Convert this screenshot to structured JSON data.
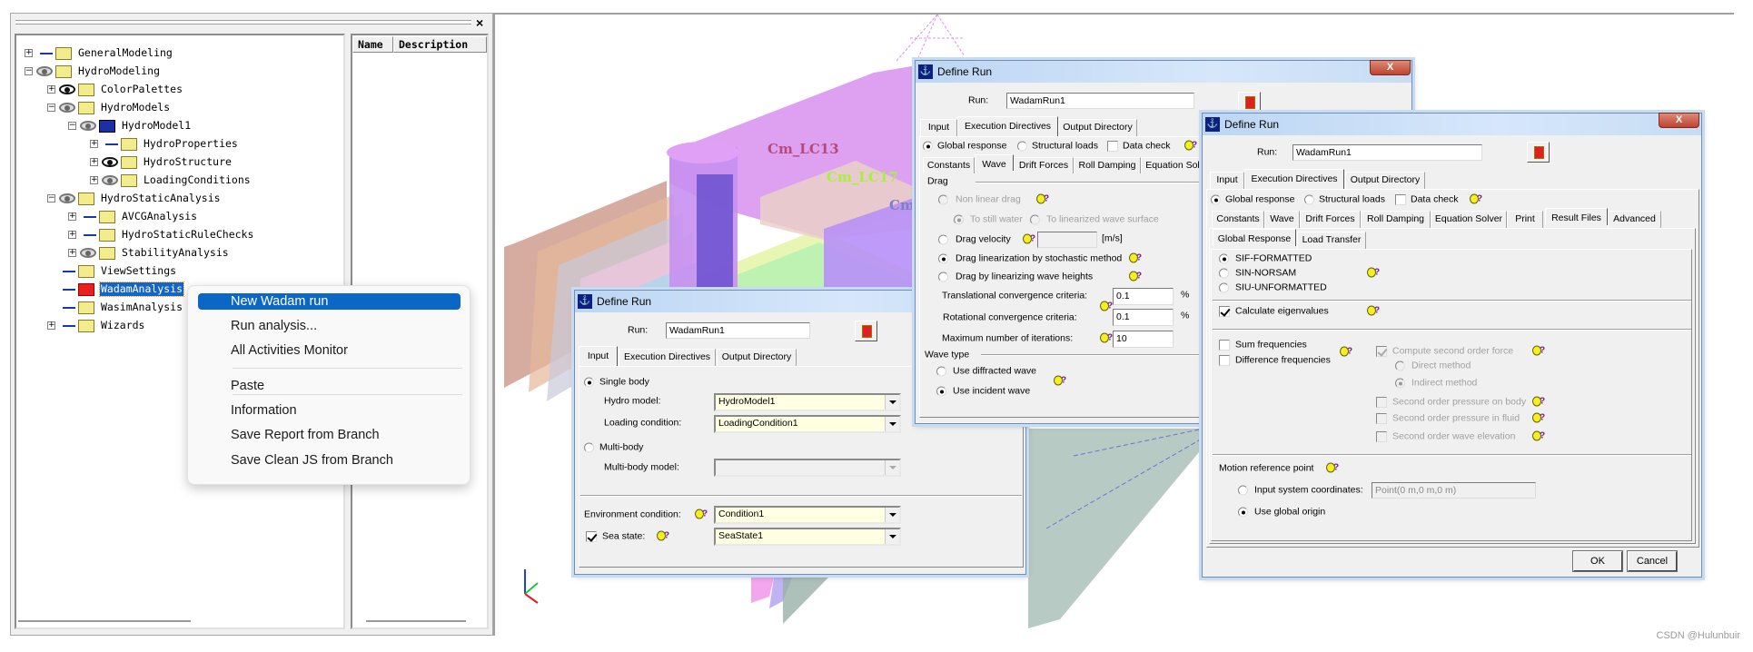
{
  "tree": [
    {
      "label": "GeneralModeling",
      "level": 0,
      "expander": "plus",
      "visibility": "hidden",
      "icon": "folder"
    },
    {
      "label": "HydroModeling",
      "level": 0,
      "expander": "minus",
      "visibility": "partial",
      "icon": "folder"
    },
    {
      "label": "ColorPalettes",
      "level": 1,
      "expander": "plus",
      "visibility": "visible",
      "icon": "folder"
    },
    {
      "label": "HydroModels",
      "level": 1,
      "expander": "minus",
      "visibility": "partial",
      "icon": "folder"
    },
    {
      "label": "HydroModel1",
      "level": 2,
      "expander": "minus",
      "visibility": "partial",
      "icon": "model"
    },
    {
      "label": "HydroProperties",
      "level": 3,
      "expander": "plus",
      "visibility": "hidden",
      "icon": "folder"
    },
    {
      "label": "HydroStructure",
      "level": 3,
      "expander": "plus",
      "visibility": "visible",
      "icon": "folder"
    },
    {
      "label": "LoadingConditions",
      "level": 3,
      "expander": "plus",
      "visibility": "partial",
      "icon": "folder"
    },
    {
      "label": "HydroStaticAnalysis",
      "level": 1,
      "expander": "minus",
      "visibility": "partial",
      "icon": "folder"
    },
    {
      "label": "AVCGAnalysis",
      "level": 2,
      "expander": "plus",
      "visibility": "hidden",
      "icon": "folder"
    },
    {
      "label": "HydroStaticRuleChecks",
      "level": 2,
      "expander": "plus",
      "visibility": "hidden",
      "icon": "folder"
    },
    {
      "label": "StabilityAnalysis",
      "level": 2,
      "expander": "plus",
      "visibility": "partial",
      "icon": "folder"
    },
    {
      "label": "ViewSettings",
      "level": 1,
      "expander": "none",
      "visibility": "hidden",
      "icon": "folder"
    },
    {
      "label": "WadamAnalysis",
      "level": 1,
      "expander": "none",
      "visibility": "hidden",
      "icon": "wadam",
      "selected": true
    },
    {
      "label": "WasimAnalysis",
      "level": 1,
      "expander": "none",
      "visibility": "hidden",
      "icon": "folder"
    },
    {
      "label": "Wizards",
      "level": 1,
      "expander": "plus",
      "visibility": "hidden",
      "icon": "folder"
    }
  ],
  "list_pane": {
    "columns": [
      "Name",
      "Description"
    ]
  },
  "viewport": {
    "labels": {
      "lc13": "Cm_LC13",
      "lc17": "Cm_LC17",
      "cm": "Cm_"
    }
  },
  "context_menu": {
    "items": [
      {
        "label": "New Wadam run",
        "highlighted": true
      },
      {
        "label": "Run analysis..."
      },
      {
        "label": "All Activities Monitor"
      },
      {
        "label": "Paste"
      },
      {
        "label": "Information"
      },
      {
        "label": "Save Report from Branch"
      },
      {
        "label": "Save Clean JS from Branch"
      }
    ]
  },
  "dialogs": {
    "input": {
      "title": "Define Run",
      "run_label": "Run:",
      "run_value": "WadamRun1",
      "tabs": [
        "Input",
        "Execution Directives",
        "Output Directory"
      ],
      "active_tab": "Input",
      "single_body": "Single body",
      "hydro_model_label": "Hydro model:",
      "hydro_model": "HydroModel1",
      "loading_label": "Loading condition:",
      "loading": "LoadingCondition1",
      "multi_body": "Multi-body",
      "multi_body_model_label": "Multi-body model:",
      "multi_body_model": "",
      "env_label": "Environment condition:",
      "env": "Condition1",
      "sea_state_label": "Sea state:",
      "sea_state": "SeaState1",
      "sea_state_checked": true
    },
    "wave": {
      "title": "Define Run",
      "run_label": "Run:",
      "run_value": "WadamRun1",
      "close": "X",
      "tabs": [
        "Input",
        "Execution Directives",
        "Output Directory"
      ],
      "active_tab": "Execution Directives",
      "mode": {
        "global": "Global response",
        "structural": "Structural loads",
        "data_check": "Data check"
      },
      "subtabs": [
        "Constants",
        "Wave",
        "Drift Forces",
        "Roll Damping",
        "Equation Sol"
      ],
      "active_subtab": "Wave",
      "drag_group": "Drag",
      "non_linear": "Non linear drag",
      "still_water": "To still water",
      "linearized_surface": "To linearized wave surface",
      "drag_velocity": "Drag velocity",
      "drag_velocity_value": "",
      "drag_velocity_unit": "[m/s]",
      "stochastic": "Drag linearization by stochastic method",
      "wave_heights": "Drag by linearizing wave heights",
      "trans_label": "Translational convergence criteria:",
      "trans_value": "0.1",
      "trans_unit": "%",
      "rot_label": "Rotational convergence criteria:",
      "rot_value": "0.1",
      "rot_unit": "%",
      "iter_label": "Maximum number of iterations:",
      "iter_value": "10",
      "wave_type_group": "Wave type",
      "diffracted": "Use diffracted wave",
      "incident": "Use incident wave"
    },
    "results": {
      "title": "Define Run",
      "run_label": "Run:",
      "run_value": "WadamRun1",
      "close": "X",
      "tabs": [
        "Input",
        "Execution Directives",
        "Output Directory"
      ],
      "active_tab": "Execution Directives",
      "mode": {
        "global": "Global response",
        "structural": "Structural loads",
        "data_check": "Data check"
      },
      "subtabs": [
        "Constants",
        "Wave",
        "Drift Forces",
        "Roll Damping",
        "Equation Solver",
        "Print",
        "Result Files",
        "Advanced"
      ],
      "active_subtab": "Result Files",
      "inner_tabs": [
        "Global Response",
        "Load Transfer"
      ],
      "active_inner_tab": "Global Response",
      "formats": [
        "SIF-FORMATTED",
        "SIN-NORSAM",
        "SIU-UNFORMATTED"
      ],
      "selected_format": "SIF-FORMATTED",
      "eigen": "Calculate eigenvalues",
      "eigen_checked": true,
      "sum_freq": "Sum frequencies",
      "diff_freq": "Difference frequencies",
      "compute_second": "Compute second order force",
      "direct": "Direct method",
      "indirect": "Indirect method",
      "press_body": "Second order pressure on body",
      "press_fluid": "Second order pressure in fluid",
      "wave_elev": "Second order wave elevation",
      "motion_ref": "Motion reference point",
      "input_coords": "Input system coordinates:",
      "coords_value": "Point(0 m,0 m,0 m)",
      "global_origin": "Use global origin",
      "ok": "OK",
      "cancel": "Cancel"
    }
  },
  "colors": {
    "selection": "#1565c8",
    "menu_highlight": "#0b67c6",
    "combo_bg": "#ffffe1",
    "model_purple": "#b070f0"
  },
  "watermark": "CSDN @Hulunbuir"
}
